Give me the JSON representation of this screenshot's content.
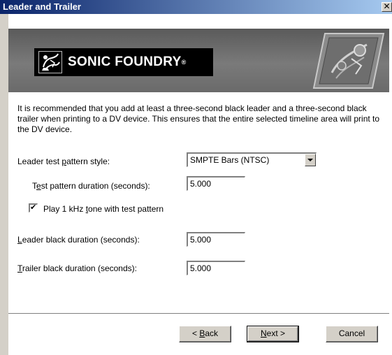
{
  "window": {
    "title": "Leader and Trailer",
    "close_glyph": "✕"
  },
  "banner": {
    "logo_text": "SONIC FOUNDRY",
    "logo_reg": "®",
    "icon_name": "sonic-foundry-logo-icon",
    "badge_name": "decorative-badge-graphic"
  },
  "description": "It is recommended that you add at least a three-second black leader and a three-second black trailer when printing to a DV device. This ensures that the entire selected timeline area will print to the DV device.",
  "form": {
    "pattern_style": {
      "label_pre": "Leader test ",
      "label_key": "p",
      "label_post": "attern style:",
      "value": "SMPTE Bars (NTSC)"
    },
    "test_duration": {
      "label_pre": "T",
      "label_key": "e",
      "label_post": "st pattern duration (seconds):",
      "value": "5.000"
    },
    "tone": {
      "label_pre": "Play 1 kHz ",
      "label_key": "t",
      "label_post": "one with test pattern",
      "checked": true
    },
    "leader_black": {
      "label_key": "L",
      "label_post": "eader black duration (seconds):",
      "value": "5.000"
    },
    "trailer_black": {
      "label_key": "T",
      "label_post": "railer black duration (seconds):",
      "value": "5.000"
    }
  },
  "buttons": {
    "back_pre": "< ",
    "back_key": "B",
    "back_post": "ack",
    "next_key": "N",
    "next_post": "ext >",
    "cancel": "Cancel"
  }
}
